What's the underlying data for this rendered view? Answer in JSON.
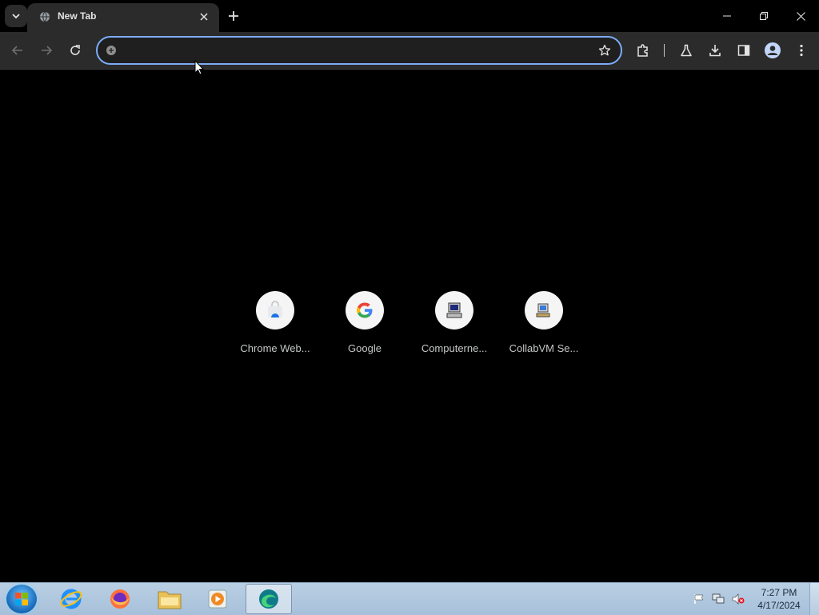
{
  "browser": {
    "tab": {
      "title": "New Tab"
    },
    "omnibox": {
      "value": "",
      "placeholder": ""
    }
  },
  "shortcuts": [
    {
      "label": "Chrome Web..."
    },
    {
      "label": "Google"
    },
    {
      "label": "Computerne..."
    },
    {
      "label": "CollabVM Se..."
    }
  ],
  "taskbar": {
    "apps": [
      "internet-explorer",
      "firefox",
      "file-explorer",
      "media-player",
      "edge"
    ],
    "clock": {
      "time": "7:27 PM",
      "date": "4/17/2024"
    }
  },
  "colors": {
    "accent": "#7cacf8",
    "toolbar": "#2b2b2b",
    "background": "#000000"
  }
}
